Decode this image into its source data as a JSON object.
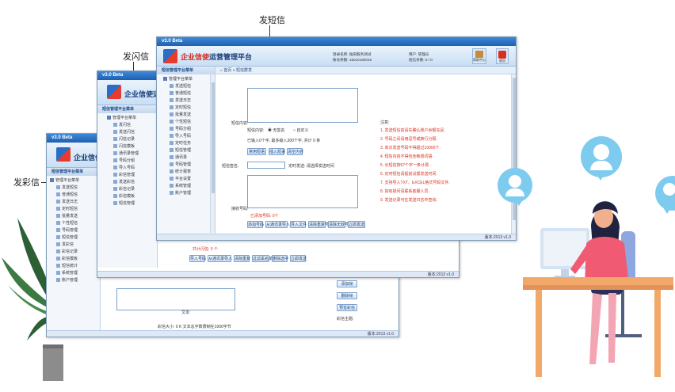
{
  "callouts": {
    "sms": "发短信",
    "flash": "发闪信",
    "mms": "发彩信"
  },
  "windows": {
    "version": "v3.0 Beta",
    "brand_name": "企业信使",
    "brand_rest": "运营管理平台",
    "brand_short_flash": "企业信使运营",
    "brand_short_mms": "企业信使运",
    "sidebar_title": "短信管理平台菜单",
    "home_label": "首页",
    "system_tab": "短信群发",
    "status": "版本:2013 v1.0"
  },
  "front": {
    "user_info_1": "登录名称: 陆阳服务测试",
    "user_info_2": "账号余额: 15010150016",
    "user_info_3": "用户: 管理员",
    "user_info_4": "短信条数: 0 / 0",
    "header_btn_1": "帮助中心",
    "header_btn_2": "退出",
    "tree": [
      "管理平台菜单",
      "发送短信",
      "普通短信",
      "发送日志",
      "定时短信",
      "批量发送",
      "个性短信",
      "号码分组",
      "导入号码",
      "定时任务",
      "短信管理",
      "通讯录",
      "号码管理",
      "统计报表",
      "平台设置",
      "系统管理",
      "账户管理"
    ],
    "form_label_content": "短信内容:",
    "form_label_sign": "短信签名:",
    "form_label_numbers": "接收号码:",
    "sig_option_a": "无签名",
    "sig_option_b": "自定义",
    "count_text": "已输入0个字, 最多输入300个字, 共计 0 条",
    "btn_row1": [
      "常用短语",
      "插入短语",
      "清空内容"
    ],
    "sign_hint": "定时发送: 请选择发送时间",
    "number_count": "已添加号码: 0个",
    "btn_row2": [
      "添加号码",
      "从通讯录导入",
      "导入文件",
      "清除重复号",
      "清除无效号",
      "立即发送"
    ],
    "notice_title": "注意:",
    "notices": [
      "1. 发送短信前请先确认账户余额充足.",
      "2. 号码之间请用逗号或换行分隔.",
      "3. 单次发送号码不得超过10000个.",
      "4. 短信内容不得包含敏感词语.",
      "5. 长短信按67个字一条计费.",
      "6. 定时短信请提前设置发送时间.",
      "7. 支持导入TXT、EXCEL格式号码文件.",
      "8. 如有疑问请联系客服人员.",
      "9. 发送记录可在发送日志中查询."
    ]
  },
  "flash_win": {
    "tree": [
      "管理平台菜单",
      "发闪信",
      "发送闪信",
      "闪信记录",
      "闪信模板",
      "通讯录管理",
      "号码分组",
      "导入号码",
      "彩信管理",
      "发送彩信",
      "彩信记录",
      "彩信模板",
      "短信管理"
    ],
    "hint": "共计闪信: 0 个",
    "buttons": [
      "导入号码",
      "从通讯录导入",
      "清除重复",
      "过滤黑名单",
      "删除选中",
      "立即发送"
    ]
  },
  "mms_win": {
    "tree": [
      "管理平台菜单",
      "发送短信",
      "普通短信",
      "发送日志",
      "定时短信",
      "批量发送",
      "个性短信",
      "号码管理",
      "短信管理",
      "发彩信",
      "彩信记录",
      "彩信模板",
      "短信统计",
      "系统管理",
      "账户管理"
    ],
    "right_buttons": [
      "添加帧",
      "删除帧",
      "预览彩信"
    ],
    "size_text": "彩信大小: 0 K 文本总字数限制在1000字节",
    "frame_label": "文本:",
    "sub_label": "彩信主题:"
  }
}
